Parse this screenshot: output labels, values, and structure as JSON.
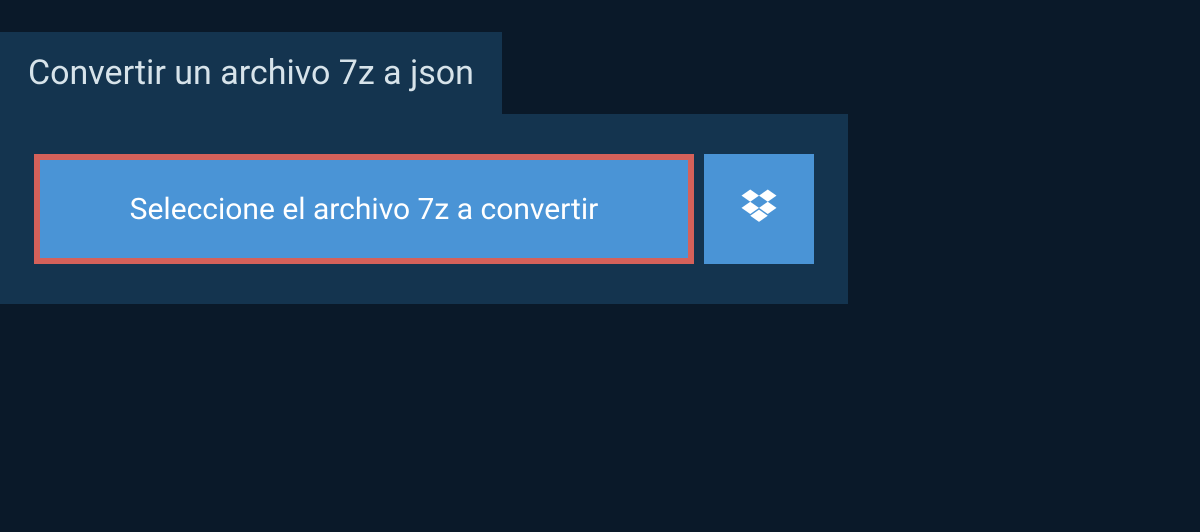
{
  "header": {
    "title": "Convertir un archivo 7z a json"
  },
  "actions": {
    "select_file_label": "Seleccione el archivo 7z a convertir"
  },
  "colors": {
    "background": "#0a1929",
    "panel": "#14344f",
    "button": "#4a94d6",
    "highlight_border": "#d5615a",
    "text_light": "#ffffff",
    "text_header": "#d7e3ea"
  }
}
